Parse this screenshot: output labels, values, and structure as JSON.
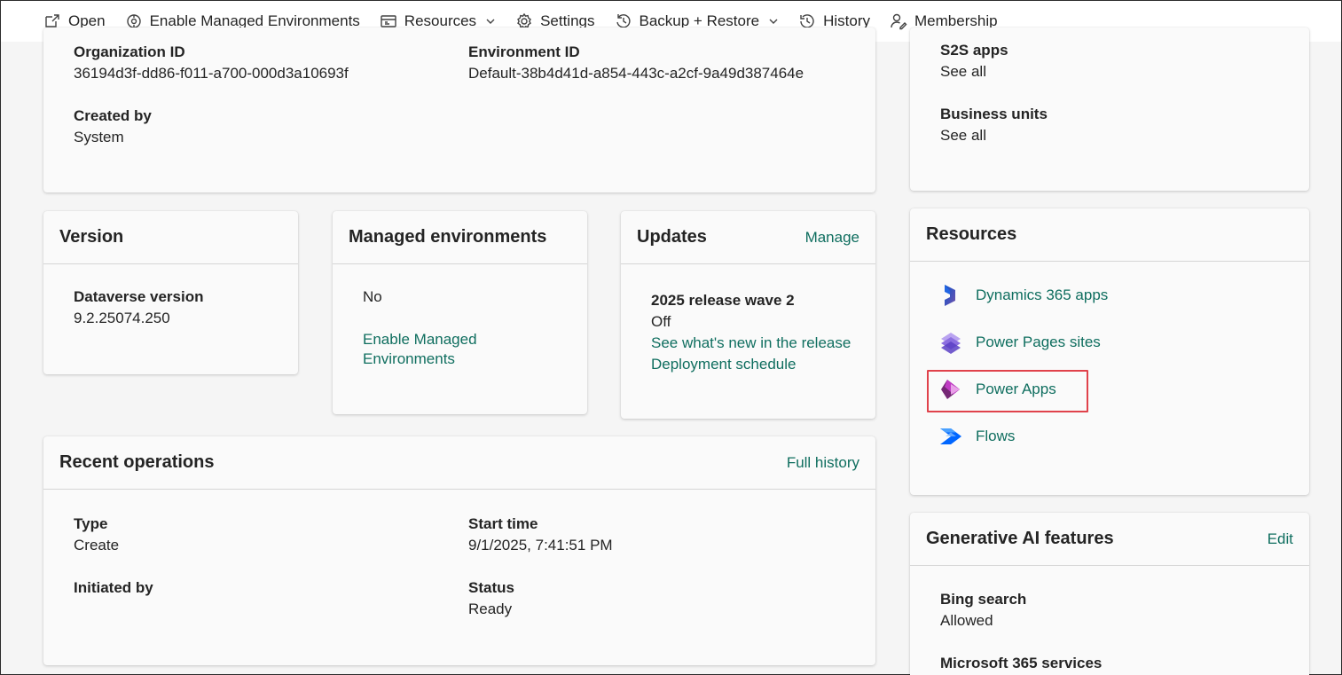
{
  "toolbar": {
    "open": "Open",
    "enable_managed": "Enable Managed Environments",
    "resources": "Resources",
    "settings": "Settings",
    "backup_restore": "Backup + Restore",
    "history": "History",
    "membership": "Membership"
  },
  "details": {
    "org_id_label": "Organization ID",
    "org_id_value": "36194d3f-dd86-f011-a700-000d3a10693f",
    "env_id_label": "Environment ID",
    "env_id_value": "Default-38b4d41d-a854-443c-a2cf-9a49d387464e",
    "created_by_label": "Created by",
    "created_by_value": "System"
  },
  "access": {
    "s2s_label": "S2S apps",
    "s2s_link": "See all",
    "bu_label": "Business units",
    "bu_link": "See all"
  },
  "version": {
    "title": "Version",
    "dv_label": "Dataverse version",
    "dv_value": "9.2.25074.250"
  },
  "managed": {
    "title": "Managed environments",
    "value": "No",
    "link_line1": "Enable Managed",
    "link_line2": "Environments"
  },
  "updates": {
    "title": "Updates",
    "manage": "Manage",
    "wave_label": "2025 release wave 2",
    "wave_value": "Off",
    "whats_new": "See what's new in the release",
    "schedule": "Deployment schedule"
  },
  "recent": {
    "title": "Recent operations",
    "full_history": "Full history",
    "type_label": "Type",
    "type_value": "Create",
    "start_label": "Start time",
    "start_value": "9/1/2025, 7:41:51 PM",
    "initiated_label": "Initiated by",
    "status_label": "Status",
    "status_value": "Ready"
  },
  "resources": {
    "title": "Resources",
    "items": [
      {
        "label": "Dynamics 365 apps",
        "icon": "dynamics-365-icon"
      },
      {
        "label": "Power Pages sites",
        "icon": "power-pages-icon"
      },
      {
        "label": "Power Apps",
        "icon": "power-apps-icon"
      },
      {
        "label": "Flows",
        "icon": "power-automate-icon"
      }
    ]
  },
  "genai": {
    "title": "Generative AI features",
    "edit": "Edit",
    "bing_label": "Bing search",
    "bing_value": "Allowed",
    "m365_label": "Microsoft 365 services"
  },
  "colors": {
    "link": "#0f6e5f",
    "highlight": "#e0424b"
  }
}
